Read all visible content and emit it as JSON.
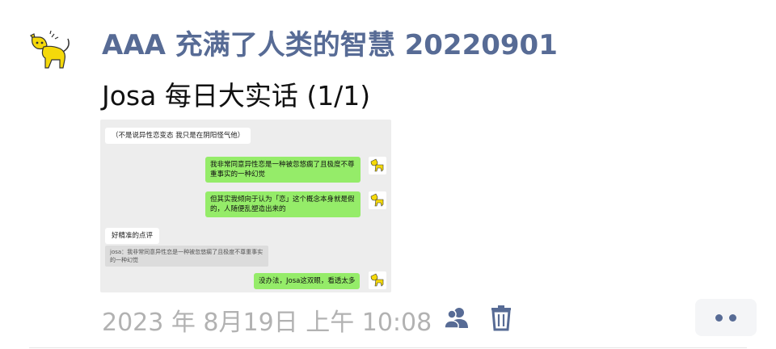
{
  "post": {
    "title": "AAA 充满了人类的智慧 20220901",
    "body": "Josa 每日大实话 (1/1)",
    "timestamp": "2023 年 8月19日 上午 10:08"
  },
  "screenshot": {
    "top_note": "（不是说异性恋变态 我只是在阴阳怪气他）",
    "bubble1": "我非常同意异性恋是一种被忽悠瘸了且极度不尊重事实的一种幻觉",
    "bubble2": "但其实我倾向于认为「恋」这个概念本身就是假的，人随便乱塑造出来的",
    "left_msg": "好精准的点评",
    "quote": "josa：我非常同意异性恋是一种被忽悠瘸了且极度不尊重事实的一种幻觉",
    "bubble3": "没办法，Josa这双眼，看透太多"
  },
  "icons": {
    "avatar": "yellow-cat-avatar",
    "people": "people-icon",
    "trash": "trash-icon",
    "more": "more-dots-icon"
  },
  "colors": {
    "link": "#576b95",
    "bubble_green": "#95ec69",
    "meta_gray": "#b2b2b2"
  }
}
